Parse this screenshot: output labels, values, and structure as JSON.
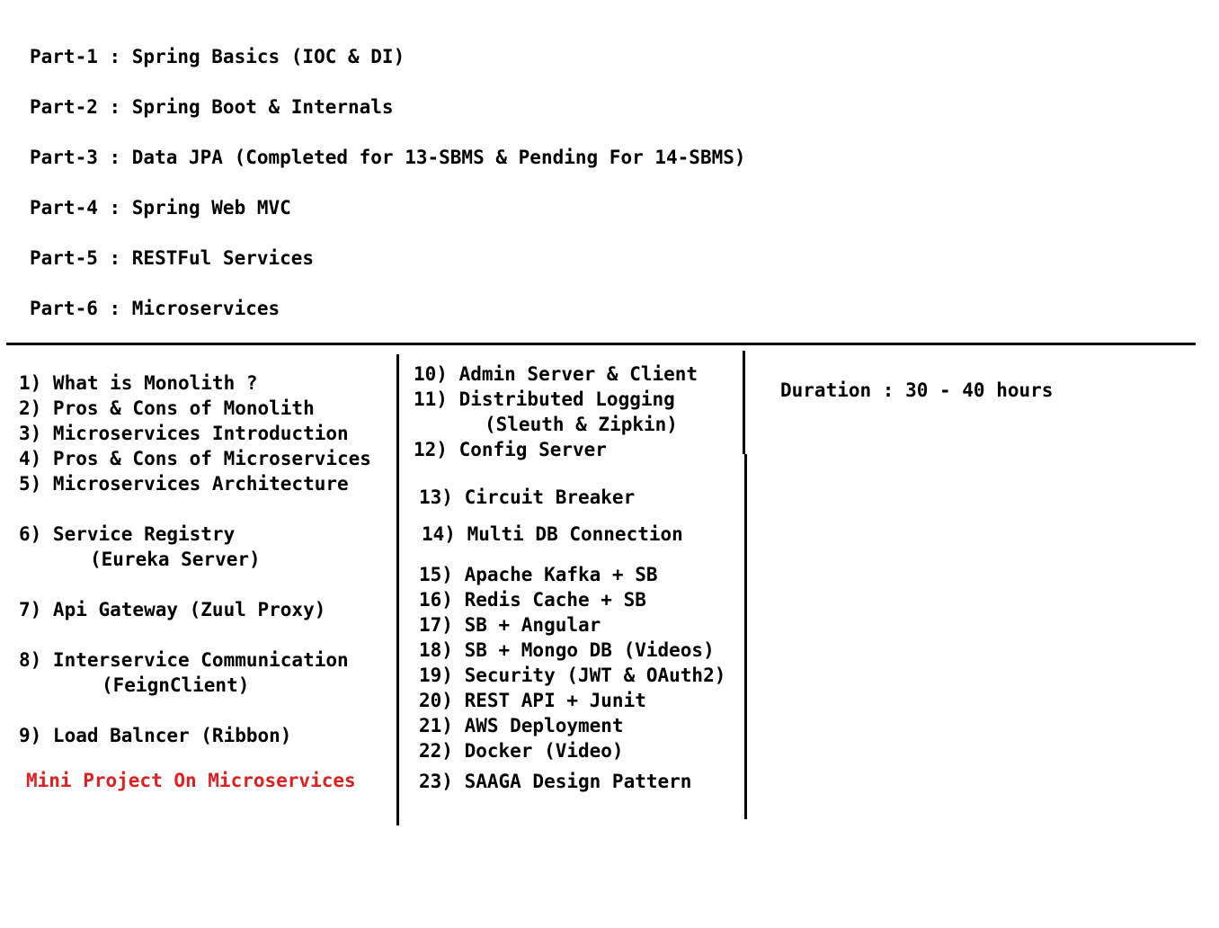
{
  "parts": [
    "Part-1 : Spring Basics (IOC & DI)",
    "Part-2 : Spring Boot & Internals",
    "Part-3 : Data JPA (Completed for 13-SBMS & Pending For 14-SBMS)",
    "Part-4 : Spring Web MVC",
    "Part-5 : RESTFul Services",
    "Part-6 : Microservices"
  ],
  "left_column": {
    "items": [
      "1) What is Monolith ?",
      "2) Pros & Cons of Monolith",
      "3) Microservices Introduction",
      "4) Pros & Cons of Microservices",
      "5) Microservices Architecture",
      "6) Service Registry",
      "(Eureka Server)",
      "7) Api Gateway (Zuul Proxy)",
      "8) Interservice Communication",
      "(FeignClient)",
      "9) Load Balncer (Ribbon)"
    ],
    "mini_project": "Mini Project On Microservices"
  },
  "middle_column": {
    "items": [
      "10) Admin Server & Client",
      "11) Distributed Logging",
      "(Sleuth & Zipkin)",
      "12) Config Server",
      "13) Circuit Breaker",
      "14) Multi DB Connection",
      "15) Apache Kafka + SB",
      "16) Redis Cache + SB",
      "17) SB + Angular",
      "18) SB + Mongo DB (Videos)",
      "19) Security (JWT & OAuth2)",
      "20) REST API + Junit",
      "21) AWS Deployment",
      "22) Docker (Video)",
      "23) SAAGA Design Pattern"
    ]
  },
  "right_column": {
    "duration": "Duration : 30 - 40 hours"
  },
  "colors": {
    "text": "#000000",
    "highlight": "#e02020",
    "background": "#ffffff"
  }
}
